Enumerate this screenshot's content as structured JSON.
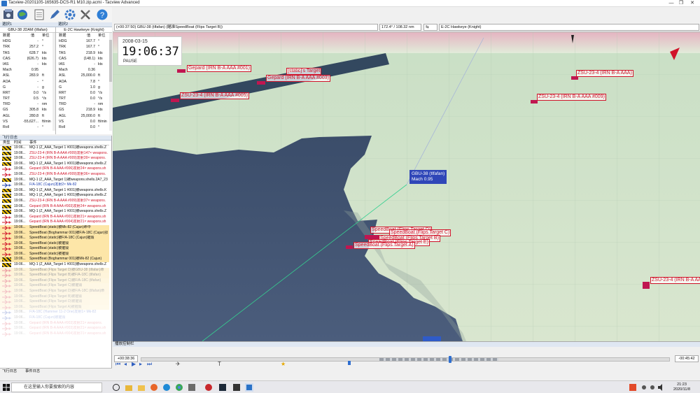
{
  "window": {
    "title": "Tacview-20201105-165635-DCS-R1 M10.zip.acmi - Tacview Advanced",
    "minimize": "—",
    "maximize": "❐",
    "close": "✕"
  },
  "toolbar": {
    "icons": [
      "open-file-icon",
      "globe-icon",
      "document-icon",
      "pen-icon",
      "settings-gear-icon",
      "tools-icon",
      "help-icon"
    ]
  },
  "object_panel_1": {
    "header": "選択1",
    "name": "GBU-38 JDAM (tlfafan)",
    "col_data": "数据",
    "col_value": "值",
    "col_unit": "单位",
    "rows": [
      {
        "k": "HDG",
        "v": "-",
        "u": "°"
      },
      {
        "k": "TRK",
        "v": "257.2",
        "u": "°"
      },
      {
        "k": "TAS",
        "v": "628.7",
        "u": "kts"
      },
      {
        "k": "CAS",
        "v": "(626.7)",
        "u": "kts"
      },
      {
        "k": "IAS",
        "v": "-",
        "u": "kts"
      },
      {
        "k": "Mach",
        "v": "0.95",
        "u": ""
      },
      {
        "k": "ASL",
        "v": "283.9",
        "u": "ft"
      },
      {
        "k": "AOA",
        "v": "-",
        "u": "°"
      },
      {
        "k": "G",
        "v": "-",
        "u": "g"
      },
      {
        "k": "RRT",
        "v": "0.0",
        "u": "°/s"
      },
      {
        "k": "TRT",
        "v": "0.5",
        "u": "°/s"
      },
      {
        "k": "TRD",
        "v": "-",
        "u": "nm"
      },
      {
        "k": "GS",
        "v": "305.8",
        "u": "kts"
      },
      {
        "k": "AGL",
        "v": "280.8",
        "u": "ft"
      },
      {
        "k": "VS",
        "v": "-55,627...",
        "u": "ft/min"
      },
      {
        "k": "Roll",
        "v": "-",
        "u": "°"
      }
    ]
  },
  "object_panel_2": {
    "header": "選択2",
    "name": "E-2C Hawkeye (Knight)",
    "col_data": "数据",
    "col_value": "值",
    "col_unit": "单位",
    "rows": [
      {
        "k": "HDG",
        "v": "167.7",
        "u": "°"
      },
      {
        "k": "TRK",
        "v": "167.7",
        "u": "°"
      },
      {
        "k": "TAS",
        "v": "218.9",
        "u": "kts"
      },
      {
        "k": "CAS",
        "v": "(148.1)",
        "u": "kts"
      },
      {
        "k": "IAS",
        "v": "-",
        "u": "kts"
      },
      {
        "k": "Mach",
        "v": "0.36",
        "u": ""
      },
      {
        "k": "ASL",
        "v": "25,000.0",
        "u": "ft"
      },
      {
        "k": "AOA",
        "v": "7.8",
        "u": "°"
      },
      {
        "k": "G",
        "v": "1.0",
        "u": "g"
      },
      {
        "k": "RRT",
        "v": "0.0",
        "u": "°/s"
      },
      {
        "k": "TRT",
        "v": "0.0",
        "u": "°/s"
      },
      {
        "k": "TRD",
        "v": "-",
        "u": "nm"
      },
      {
        "k": "GS",
        "v": "218.9",
        "u": "kts"
      },
      {
        "k": "AGL",
        "v": "25,000.0",
        "u": "ft"
      },
      {
        "k": "VS",
        "v": "0.0",
        "u": "ft/min"
      },
      {
        "k": "Roll",
        "v": "0.0",
        "u": "°"
      }
    ]
  },
  "log": {
    "header": "飞行日志",
    "col_type": "类型",
    "col_time": "时间",
    "col_event": "事件",
    "rows": [
      {
        "icon": "stripe",
        "time": "19:06...",
        "event": "MQ-1 (Z_AAA_Target 1 #001)被weapons.shells.Z",
        "color": "#111",
        "bg": "#fff",
        "fade": 1
      },
      {
        "icon": "stripe",
        "time": "19:06...",
        "event": "ZSU-23-4 (IRN B-A AAA #009)发射147× weapons.",
        "color": "#d0142a",
        "bg": "#fff",
        "fade": 1
      },
      {
        "icon": "stripe",
        "time": "19:06...",
        "event": "ZSU-23-4 (IRN B-A AAA #009)发射39× weapons.",
        "color": "#d0142a",
        "bg": "#fff",
        "fade": 1
      },
      {
        "icon": "stripe",
        "time": "19:06...",
        "event": "MQ-1 (Z_AAA_Target 1 #001)被weapons.shells.Z",
        "color": "#111",
        "bg": "#fff",
        "fade": 1
      },
      {
        "icon": "plane-r",
        "time": "19:06...",
        "event": "Gepard (IRN B-A AAA #006)发射24× weapons.sh",
        "color": "#d0142a",
        "bg": "#fff",
        "fade": 1
      },
      {
        "icon": "plane-r",
        "time": "19:06...",
        "event": "ZSU-23-4 (IRN B-A AAA #009)发射36× weapons.",
        "color": "#d0142a",
        "bg": "#fff",
        "fade": 1
      },
      {
        "icon": "stripe",
        "time": "19:06...",
        "event": "MQ-1 (Z_AAA_Target 1)被weapons.shells.2A7_23",
        "color": "#111",
        "bg": "#fff",
        "fade": 1
      },
      {
        "icon": "plane-b",
        "time": "19:06...",
        "event": "F/A-18C (Cajun)发射2× Mk-82",
        "color": "#1d3fb0",
        "bg": "#fff",
        "fade": 1
      },
      {
        "icon": "stripe",
        "time": "19:06...",
        "event": "MQ-1 (Z_AAA_Target 1 #001)被weapons.shells.K",
        "color": "#111",
        "bg": "#fff",
        "fade": 1
      },
      {
        "icon": "stripe",
        "time": "19:06...",
        "event": "MQ-1 (Z_AAA_Target 1 #001)被weapons.shells.Z",
        "color": "#111",
        "bg": "#fff",
        "fade": 1
      },
      {
        "icon": "stripe",
        "time": "19:06...",
        "event": "ZSU-23-4 (IRN B-A AAA #009)发射37× weapons.",
        "color": "#d0142a",
        "bg": "#fff",
        "fade": 1
      },
      {
        "icon": "stripe",
        "time": "19:06...",
        "event": "Gepard (IRN B-A AAA #003)发射24× weapons.sh",
        "color": "#d0142a",
        "bg": "#fff",
        "fade": 1
      },
      {
        "icon": "stripe",
        "time": "19:06...",
        "event": "MQ-1 (Z_AAA_Target 1 #001)被weapons.shells.Z",
        "color": "#111",
        "bg": "#fff",
        "fade": 1
      },
      {
        "icon": "plane-r",
        "time": "19:06...",
        "event": "Gepard (IRN B-A AAA #001)发射21× weapons.sh",
        "color": "#d0142a",
        "bg": "#fff",
        "fade": 1
      },
      {
        "icon": "plane-r",
        "time": "19:06...",
        "event": "Gepard (IRN B-A AAA #004)发射21× weapons.sh",
        "color": "#d0142a",
        "bg": "#fff",
        "fade": 1
      },
      {
        "icon": "plane-r",
        "time": "19:06...",
        "event": "SpeedBoat (static)被Mk-82 (Cajun)命中",
        "color": "#111",
        "bg": "#fde6a8",
        "fade": 1
      },
      {
        "icon": "plane-r",
        "time": "19:06...",
        "event": "SpeedBoat (Boghammar 001)被F/A-18C (Cajun)损",
        "color": "#111",
        "bg": "#fde6a8",
        "fade": 1
      },
      {
        "icon": "plane-r",
        "time": "19:06...",
        "event": "SpeedBoat (static)被F/A-18C (Cajun)摧毁",
        "color": "#111",
        "bg": "#fde6a8",
        "fade": 1
      },
      {
        "icon": "plane-r",
        "time": "19:06...",
        "event": "SpeedBoat (static)被摧毁",
        "color": "#111",
        "bg": "#fde6a8",
        "fade": 1
      },
      {
        "icon": "plane-r",
        "time": "19:06...",
        "event": "SpeedBoat (static)被摧毁",
        "color": "#111",
        "bg": "#fde6a8",
        "fade": 1
      },
      {
        "icon": "plane-r",
        "time": "19:06...",
        "event": "SpeedBoat (static)被摧毁",
        "color": "#111",
        "bg": "#fde6a8",
        "fade": 1
      },
      {
        "icon": "stripe",
        "time": "19:06...",
        "event": "SpeedBoat (Boghammar 001)被Mk-82 (Cajun)",
        "color": "#111",
        "bg": "#fde6a8",
        "fade": 1
      },
      {
        "icon": "stripe",
        "time": "19:06...",
        "event": "MQ-1 (Z_AAA_Target 1 #001)被weapons.shells.Z",
        "color": "#111",
        "bg": "#fff",
        "fade": 1
      },
      {
        "icon": "plane-r",
        "time": "19:06...",
        "event": "SpeedBoat (Flips Target D)被GBU-38 (tlfafan)命",
        "color": "#111",
        "bg": "#fde6a8",
        "fade": 0.45
      },
      {
        "icon": "plane-r",
        "time": "19:06...",
        "event": "SpeedBoat (Flips Target B)被F/A-18C (tlfafan)",
        "color": "#111",
        "bg": "#fde6a8",
        "fade": 0.4
      },
      {
        "icon": "plane-r",
        "time": "19:06...",
        "event": "SpeedBoat (Flips Target C)被F/A-18C (tlfafan)",
        "color": "#111",
        "bg": "#fde6a8",
        "fade": 0.35
      },
      {
        "icon": "plane-r",
        "time": "19:06...",
        "event": "SpeedBoat (Flips Target C)被摧毁",
        "color": "#111",
        "bg": "#fde6a8",
        "fade": 0.3
      },
      {
        "icon": "plane-r",
        "time": "19:06...",
        "event": "SpeedBoat (Flips Target D)被F/A-18C (tlfafan)命",
        "color": "#111",
        "bg": "#fde6a8",
        "fade": 0.28
      },
      {
        "icon": "plane-r",
        "time": "19:06...",
        "event": "SpeedBoat (Flips Target B)被摧毁",
        "color": "#111",
        "bg": "#fde6a8",
        "fade": 0.26
      },
      {
        "icon": "plane-r",
        "time": "19:06...",
        "event": "SpeedBoat (Flips Target D)被摧毁",
        "color": "#111",
        "bg": "#fde6a8",
        "fade": 0.24
      },
      {
        "icon": "plane-r",
        "time": "19:06...",
        "event": "SpeedBoat (Flips Target A)被摧毁",
        "color": "#111",
        "bg": "#fde6a8",
        "fade": 0.22
      },
      {
        "icon": "plane-b",
        "time": "19:06...",
        "event": "F/A-18C (Hammer 11-2 One)发射1× Mk-82",
        "color": "#1d3fb0",
        "bg": "#fff",
        "fade": 0.25
      },
      {
        "icon": "plane-b",
        "time": "19:06...",
        "event": "F/A-18C (Cajun)被摧毁",
        "color": "#1d3fb0",
        "bg": "#fff",
        "fade": 0.22
      },
      {
        "icon": "plane-r",
        "time": "19:06...",
        "event": "Gepard (IRN B-A AAA #003)发射21× weapons.",
        "color": "#d0142a",
        "bg": "#fff",
        "fade": 0.2
      },
      {
        "icon": "plane-r",
        "time": "19:06...",
        "event": "Gepard (IRN B-A AAA #003)发射21× weapons.sh",
        "color": "#d0142a",
        "bg": "#fff",
        "fade": 0.18
      },
      {
        "icon": "plane-r",
        "time": "19:06...",
        "event": "Gepard (IRN B-A AAA #004)发射21× weapons.sh",
        "color": "#d0142a",
        "bg": "#fff",
        "fade": 0.16
      }
    ],
    "tab_flight": "飞行日志",
    "tab_event": "事件日志"
  },
  "viewbar": {
    "combo1": "(+00:37:50) GBU-38 (tlfafan) (瞄准SpeedBoat (Flips Target B))",
    "combo2": "172.4° / 108.32 nm",
    "combo3": "E-2C Hawkeye (Knight)"
  },
  "view3d": {
    "date": "2008-03-15",
    "time": "19:06:37",
    "state": "PAUSE",
    "labels": [
      {
        "text": "Gepard (IRN B-A AAA #001)",
        "style": "red"
      },
      {
        "text": "[static]'s Target",
        "style": "red"
      },
      {
        "text": "Gepard (IRN B-A AAA #003)",
        "style": "red"
      },
      {
        "text": "ZSU-23-4 (IRN B-A AAA #005)",
        "style": "red"
      },
      {
        "text": "ZSU-23-4 (IRN B-A AAA)",
        "style": "red"
      },
      {
        "text": "ZSU-23-4 (IRN B-A AAA #009)",
        "style": "red"
      },
      {
        "text": "ZSU-23-4 (IRN B-A AAA",
        "style": "red"
      },
      {
        "text": "SpeedBoat (Flips Target D)",
        "style": "red"
      },
      {
        "text": "SpeedBoat (Flips Target C)",
        "style": "red"
      },
      {
        "text": "SpeedBoat (Flips Target B)",
        "style": "red"
      },
      {
        "text": "SpeedBoat (Flips Target E)",
        "style": "red"
      },
      {
        "text": "SpeedBoat (Flips Target A)",
        "style": "red"
      }
    ],
    "bomb_label_1": "GBU-38 (tlfafan)",
    "bomb_label_2": "Mach 0.95"
  },
  "playback": {
    "header": "播放控制栏",
    "start": "+00:38:36",
    "end": "-00:45:42",
    "progress": 0.585
  },
  "taskbar": {
    "search_placeholder": "在这里输入你要搜索的内容",
    "time": "21:23",
    "date": "2020/11/8"
  }
}
